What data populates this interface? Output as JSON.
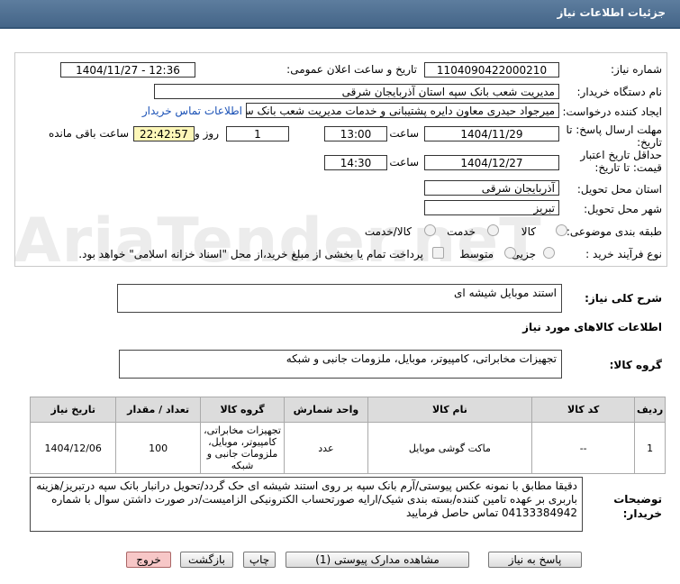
{
  "header": {
    "title": "جزئیات اطلاعات نیاز"
  },
  "form": {
    "need_number_label": "شماره نیاز:",
    "need_number": "1104090422000210",
    "announce_label": "تاریخ و ساعت اعلان عمومی:",
    "announce_value": "1404/11/27 - 12:36",
    "buyer_label": "نام دستگاه خریدار:",
    "buyer_value": "مدیریت شعب بانک سپه استان آذربایجان شرقی",
    "creator_label": "ایجاد کننده درخواست:",
    "creator_value": "میرجواد حیدری معاون دایره پشتیبانی و خدمات مدیریت شعب بانک سپه استان آ",
    "contact_link": "اطلاعات تماس خریدار",
    "deadline_label": "مهلت ارسال پاسخ: تا تاریخ:",
    "deadline_date": "1404/11/29",
    "time_label": "ساعت",
    "deadline_time": "13:00",
    "days_value": "1",
    "days_label": "روز و",
    "remaining_time": "22:42:57",
    "remaining_label": "ساعت باقی مانده",
    "validity_label": "حداقل تاریخ اعتبار قیمت: تا تاریخ:",
    "validity_date": "1404/12/27",
    "validity_time": "14:30",
    "province_label": "استان محل تحویل:",
    "province_value": "آذربایجان شرقی",
    "city_label": "شهر محل تحویل:",
    "city_value": "تبریز",
    "category_label": "طبقه بندی موضوعی:",
    "category_options": [
      "کالا",
      "خدمت",
      "کالا/خدمت"
    ],
    "process_label": "نوع فرآیند خرید :",
    "process_options": [
      "جزیی",
      "متوسط"
    ],
    "payment_note": "پرداخت تمام یا بخشی از مبلغ خرید،از محل \"اسناد خزانه اسلامی\" خواهد بود."
  },
  "summary": {
    "label": "شرح کلی نیاز:",
    "value": "استند موبایل شیشه ای"
  },
  "goods_info": {
    "title": "اطلاعات کالاهای مورد نیاز",
    "group_label": "گروه کالا:",
    "group_value": "تجهیزات مخابراتی، کامپیوتر، موبایل، ملزومات جانبی و شبکه"
  },
  "table": {
    "headers": [
      "ردیف",
      "کد کالا",
      "نام کالا",
      "واحد شمارش",
      "گروه کالا",
      "تعداد / مقدار",
      "تاریخ نیاز"
    ],
    "rows": [
      {
        "row": "1",
        "code": "--",
        "name": "ماکت گوشی موبایل",
        "unit": "عدد",
        "group": "تجهیزات مخابراتی، کامپیوتر، موبایل، ملزومات جانبی و شبکه",
        "qty": "100",
        "date": "1404/12/06"
      }
    ]
  },
  "notes": {
    "label": "توضیحات خریدار:",
    "text": "دقیقا مطابق با نمونه عکس پیوستی/آرم بانک سپه بر روی استند شیشه ای حک گردد/تحویل درانبار بانک سپه درتبریز/هزینه باربری بر عهده تامین کننده/بسته بندی شیک/ارایه صورتحساب الکترونیکی الزامیست/در صورت داشتن سوال با شماره 04133384942 تماس حاصل فرمایید"
  },
  "buttons": {
    "reply": "پاسخ به نیاز",
    "attachments": "مشاهده مدارک پیوستی (1)",
    "print": "چاپ",
    "back": "بازگشت",
    "exit": "خروج"
  },
  "watermark": "AriaTender.neT"
}
